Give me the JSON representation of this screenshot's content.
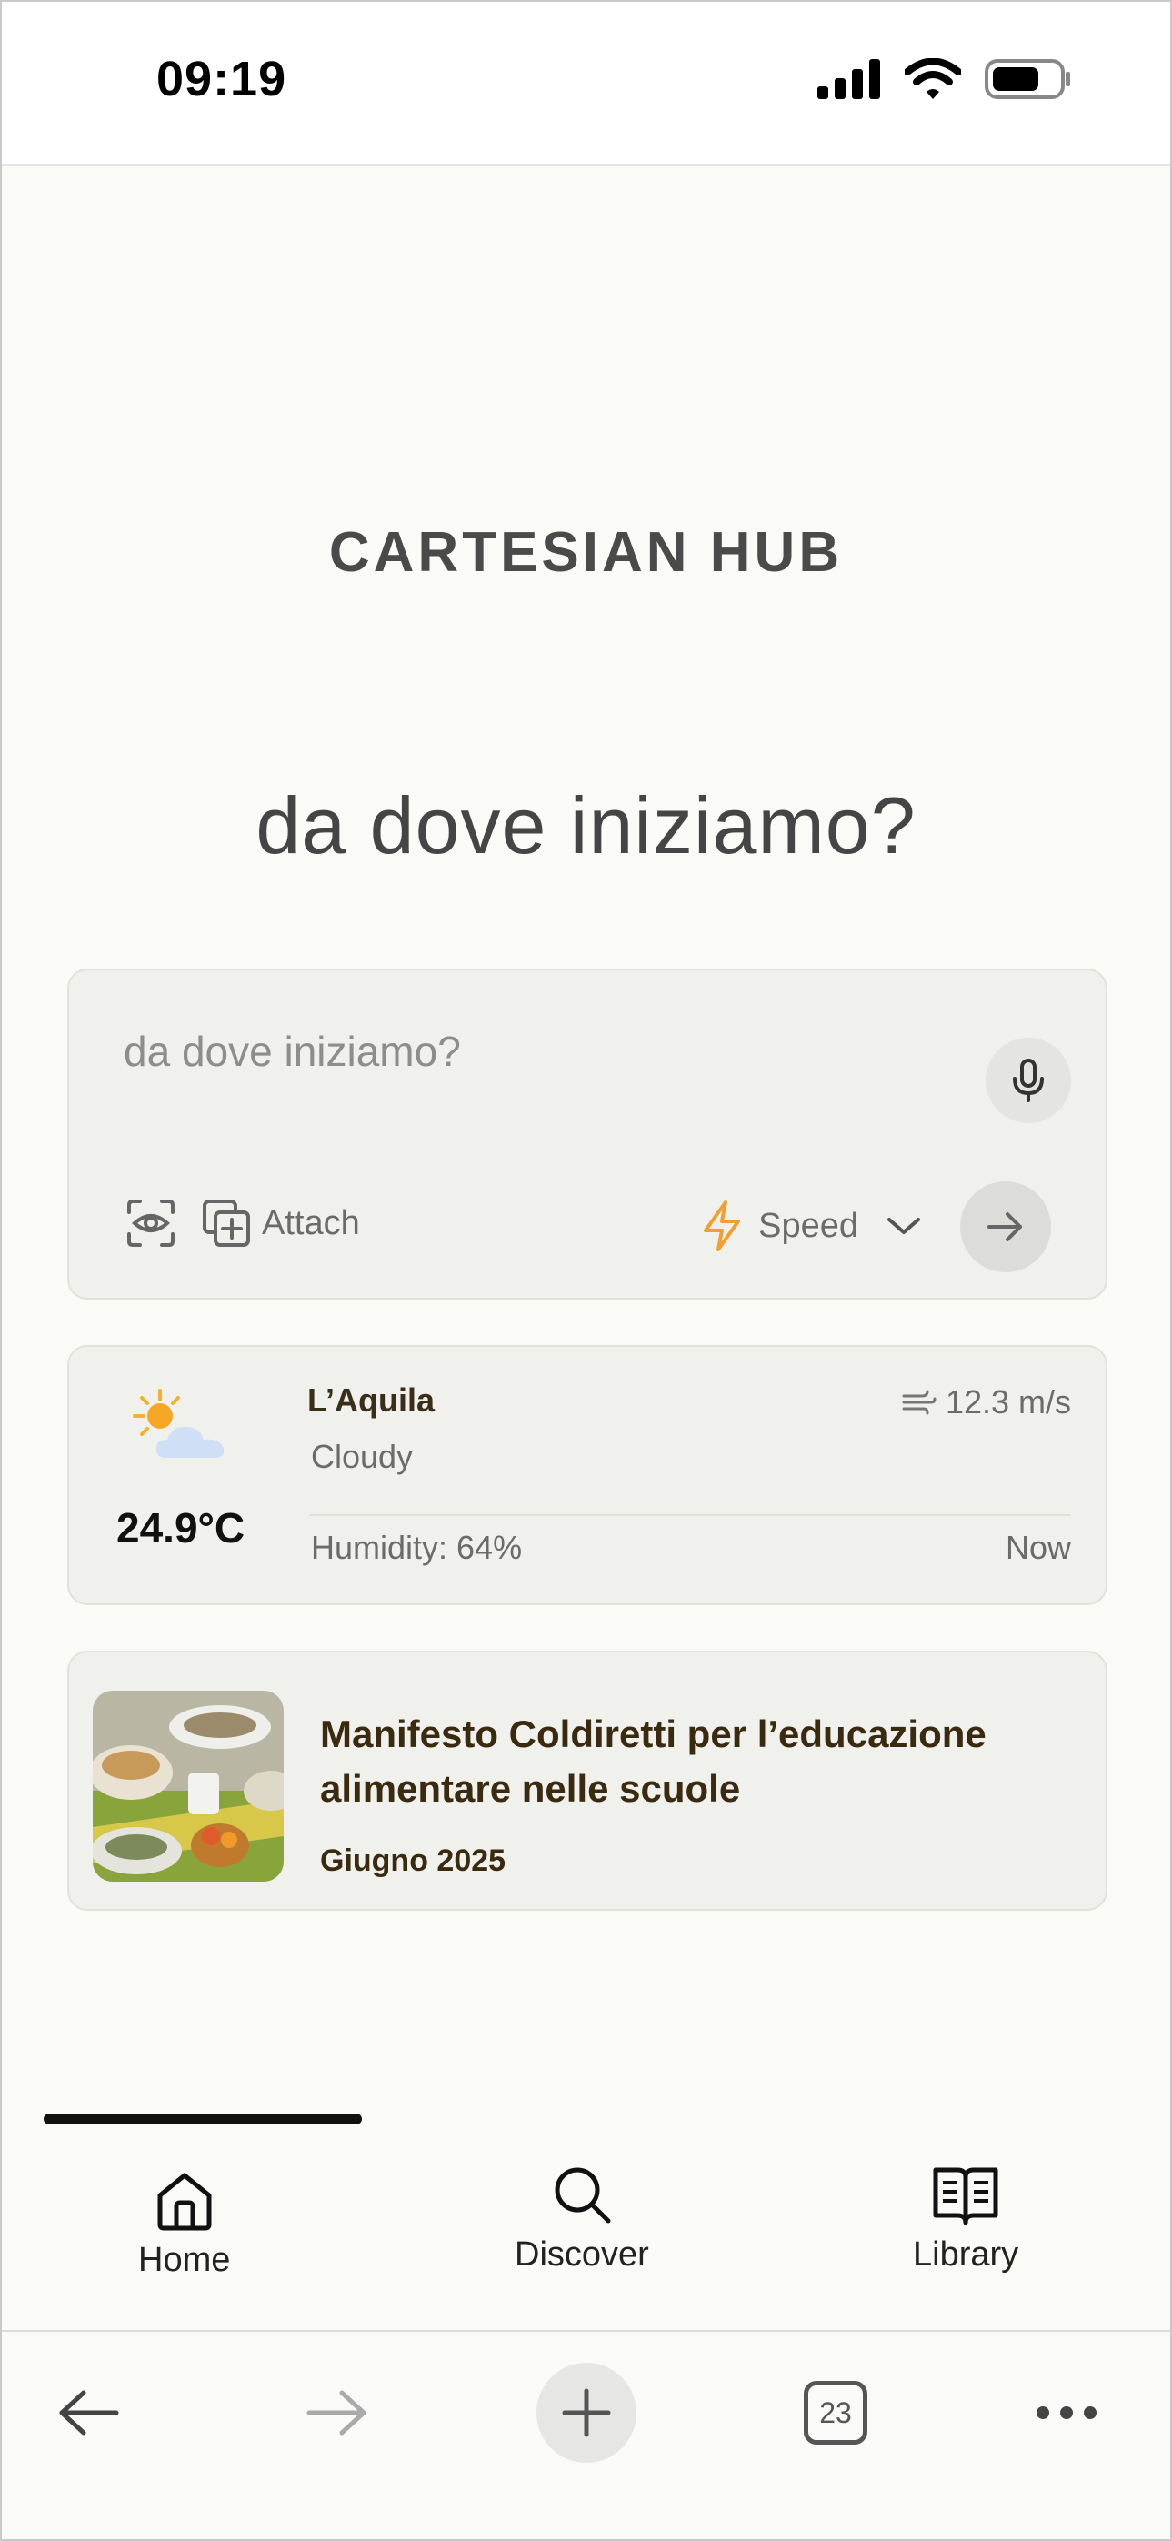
{
  "status_bar": {
    "time": "09:19"
  },
  "brand": {
    "logo_text": "CARTESIAN HUB"
  },
  "headline": "da dove iniziamo?",
  "composer": {
    "placeholder": "da dove iniziamo?",
    "attach_label": "Attach",
    "mode_label": "Speed",
    "icons": [
      "vision-icon",
      "attach-icon",
      "microphone-icon",
      "bolt-icon",
      "chevron-down-icon",
      "arrow-right-icon"
    ]
  },
  "weather": {
    "city": "L’Aquila",
    "condition": "Cloudy",
    "temperature": "24.9°C",
    "wind": "12.3 m/s",
    "humidity": "Humidity: 64%",
    "time": "Now"
  },
  "news": {
    "title": "Manifesto Coldiretti per l’educazione alimentare nelle scuole",
    "date": "Giugno 2025"
  },
  "app_nav": {
    "items": [
      {
        "label": "Home",
        "icon": "home-icon"
      },
      {
        "label": "Discover",
        "icon": "search-icon"
      },
      {
        "label": "Library",
        "icon": "book-icon"
      }
    ]
  },
  "browser_bar": {
    "tab_count": "23"
  },
  "colors": {
    "background": "#fafaf6",
    "card": "#f0f0ec",
    "accent_bolt": "#f0a030",
    "title_brown": "#3a2a10"
  }
}
